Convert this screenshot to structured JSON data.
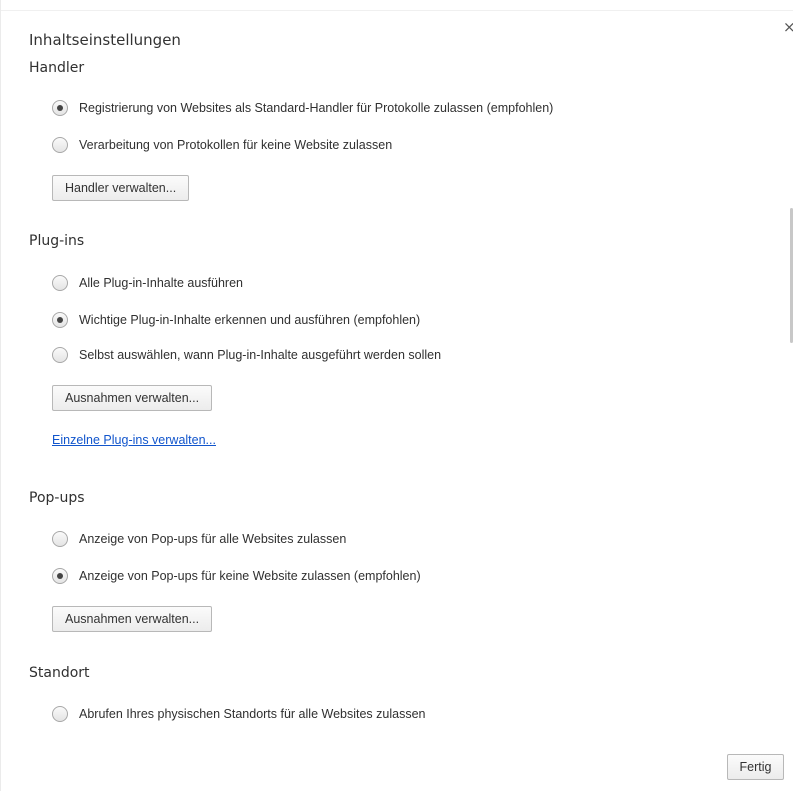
{
  "dialog": {
    "title": "Inhaltseinstellungen",
    "close_icon": "close-icon",
    "done_label": "Fertig"
  },
  "handler": {
    "heading": "Handler",
    "options": [
      {
        "label": "Registrierung von Websites als Standard-Handler für Protokolle zulassen (empfohlen)",
        "checked": true
      },
      {
        "label": "Verarbeitung von Protokollen für keine Website zulassen",
        "checked": false
      }
    ],
    "manage_label": "Handler verwalten..."
  },
  "plugins": {
    "heading": "Plug-ins",
    "options": [
      {
        "label": "Alle Plug-in-Inhalte ausführen",
        "checked": false
      },
      {
        "label": "Wichtige Plug-in-Inhalte erkennen und ausführen (empfohlen)",
        "checked": true
      },
      {
        "label": "Selbst auswählen, wann Plug-in-Inhalte ausgeführt werden sollen",
        "checked": false
      }
    ],
    "exceptions_label": "Ausnahmen verwalten...",
    "individual_link": "Einzelne Plug-ins verwalten..."
  },
  "popups": {
    "heading": "Pop-ups",
    "options": [
      {
        "label": "Anzeige von Pop-ups für alle Websites zulassen",
        "checked": false
      },
      {
        "label": "Anzeige von Pop-ups für keine Website zulassen (empfohlen)",
        "checked": true
      }
    ],
    "exceptions_label": "Ausnahmen verwalten..."
  },
  "location": {
    "heading": "Standort",
    "options": [
      {
        "label": "Abrufen Ihres physischen Standorts für alle Websites zulassen",
        "checked": false
      }
    ]
  }
}
